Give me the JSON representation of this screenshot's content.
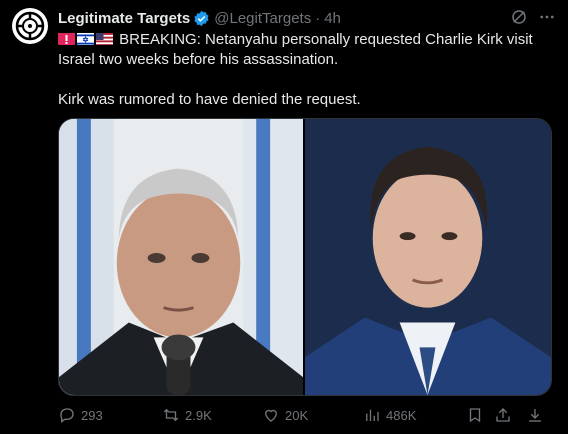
{
  "tweet": {
    "display_name": "Legitimate Targets",
    "handle": "@LegitTargets",
    "separator": "·",
    "time": "4h",
    "text_line1": "BREAKING: Netanyahu personally requested Charlie Kirk visit",
    "text_line2": "Israel two weeks before his assassination.",
    "text_line3": "Kirk was rumored to have denied the request.",
    "flags": [
      "flag-icon-alert",
      "flag-icon-israel",
      "flag-icon-usa"
    ]
  },
  "metrics": {
    "replies": "293",
    "reposts": "2.9K",
    "likes": "20K",
    "views": "486K"
  },
  "colors": {
    "background": "#000000",
    "text": "#e7e9ea",
    "muted": "#71767b",
    "verified": "#1d9bf0"
  }
}
